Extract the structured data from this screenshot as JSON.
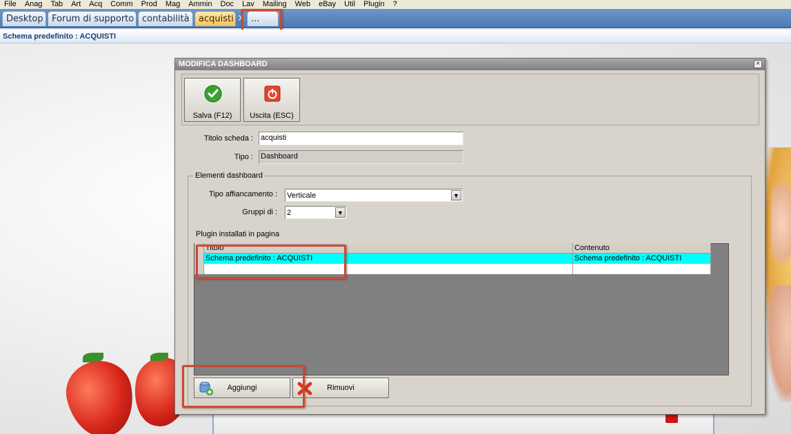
{
  "menu": [
    "File",
    "Anag",
    "Tab",
    "Art",
    "Acq",
    "Comm",
    "Prod",
    "Mag",
    "Ammin",
    "Doc",
    "Lav",
    "Mailing",
    "Web",
    "eBay",
    "Util",
    "Plugin",
    "?"
  ],
  "tabs": [
    {
      "label": "Desktop"
    },
    {
      "label": "Forum di supporto"
    },
    {
      "label": "contabilità"
    },
    {
      "label": "acquisti"
    },
    {
      "label": "..."
    }
  ],
  "tab_close_glyph": "×",
  "breadcrumb": "Schema predefinito : ACQUISTI",
  "dialog": {
    "title": "MODIFICA DASHBOARD",
    "close_glyph": "×",
    "save_label": "Salva (F12)",
    "exit_label": "Uscita (ESC)",
    "titolo_label": "Titolo scheda :",
    "titolo_value": "acquisti",
    "tipo_label": "Tipo :",
    "tipo_value": "Dashboard",
    "group_title": "Elementi dashboard",
    "tipo_aff_label": "Tipo affiancamento :",
    "tipo_aff_value": "Verticale",
    "gruppi_label": "Gruppi di :",
    "gruppi_value": "2",
    "plugins_label": "Plugin installati in pagina",
    "grid": {
      "headers": [
        "Titolo",
        "Contenuto"
      ],
      "rows": [
        [
          "Schema predefinito : ACQUISTI",
          "Schema predefinito : ACQUISTI"
        ]
      ]
    },
    "add_label": "Aggiungi",
    "remove_label": "Rimuovi"
  },
  "colors": {
    "highlight": "#c94a33",
    "selected_row": "#00ffff",
    "active_tab": "#f4c15c"
  }
}
